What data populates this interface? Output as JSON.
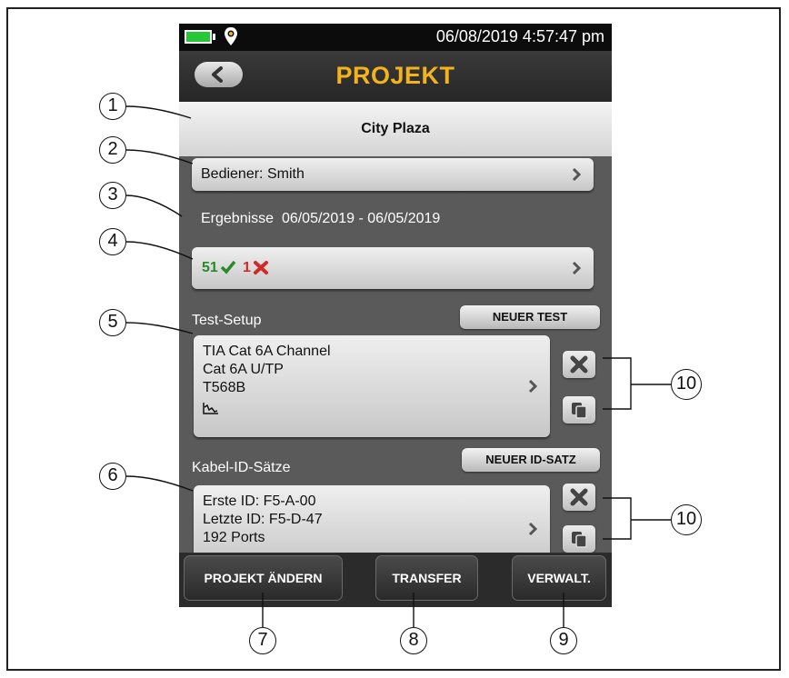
{
  "status": {
    "datetime": "06/08/2019 4:57:47 pm"
  },
  "header": {
    "title": "PROJEKT"
  },
  "project": {
    "name": "City Plaza"
  },
  "operator": {
    "label": "Bediener: Smith"
  },
  "results": {
    "label": "Ergebnisse",
    "date_range": "06/05/2019 - 06/05/2019",
    "pass_count": "51",
    "fail_count": "1"
  },
  "test_setup": {
    "section_label": "Test-Setup",
    "new_button": "NEUER TEST",
    "lines": [
      "TIA Cat 6A Channel",
      "Cat 6A U/TP",
      "T568B"
    ]
  },
  "cable_ids": {
    "section_label": "Kabel-ID-Sätze",
    "new_button": "NEUER ID-SATZ",
    "lines": [
      "Erste ID: F5-A-00",
      "Letzte ID: F5-D-47",
      "192 Ports"
    ]
  },
  "bottom": {
    "change_project": "PROJEKT ÄNDERN",
    "transfer": "TRANSFER",
    "manage": "VERWALT."
  },
  "callouts": [
    "1",
    "2",
    "3",
    "4",
    "5",
    "6",
    "7",
    "8",
    "9",
    "10",
    "10"
  ],
  "colors": {
    "accent": "#f4b31a",
    "pass": "#2a8a2a",
    "fail": "#d12a2a",
    "battery": "#28c738"
  }
}
